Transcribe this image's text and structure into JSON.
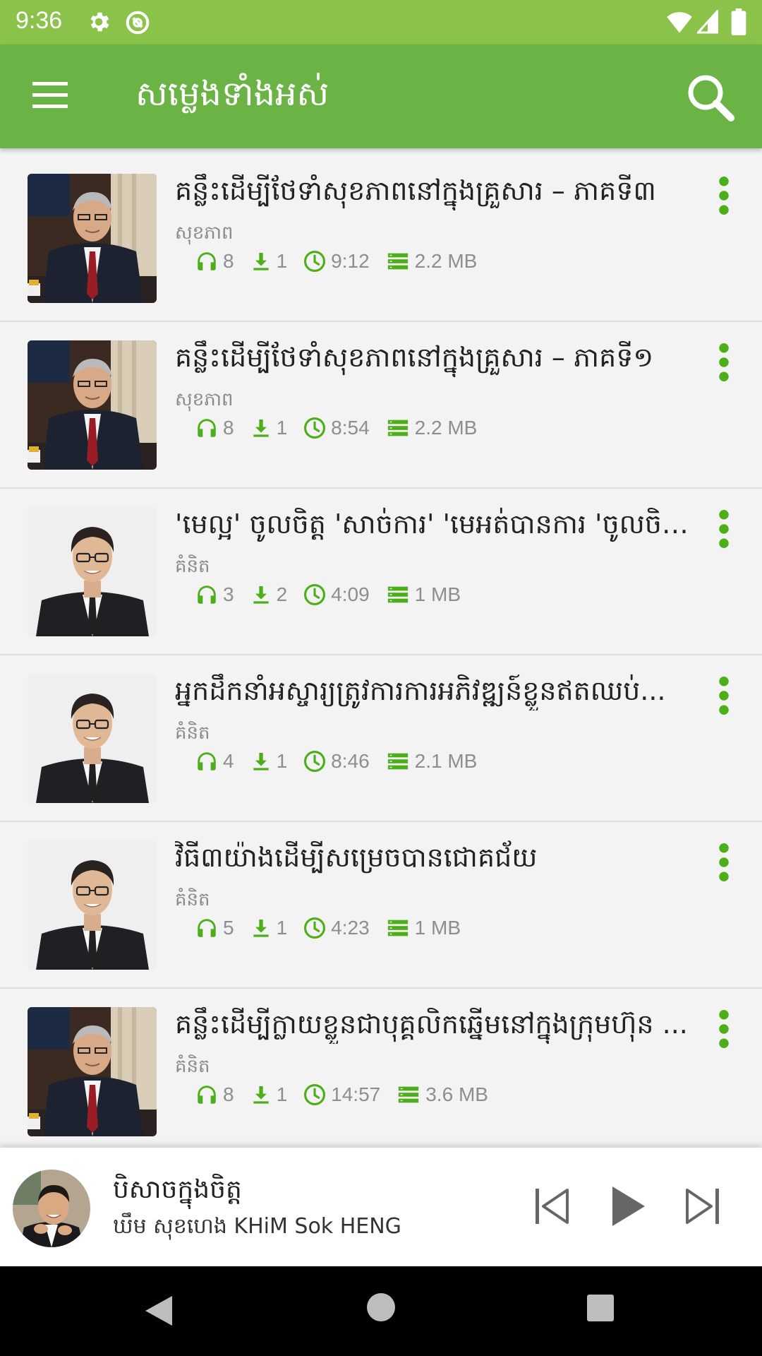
{
  "status_bar": {
    "time": "9:36",
    "icons": [
      "gear-icon",
      "ring-icon",
      "wifi-icon",
      "signal-icon",
      "battery-icon"
    ]
  },
  "app_bar": {
    "title": "សម្លេងទាំងអស់",
    "icons": [
      "menu-icon",
      "search-icon"
    ]
  },
  "theme": {
    "accent": "#6ab344",
    "status_bar": "#8bc34a",
    "icon_green": "#4caf1a"
  },
  "items": [
    {
      "title": "គន្លឹះដើម្បីថែទាំសុខភាពនៅក្នុងគ្រួសារ – ភាគទី៣",
      "category": "សុខភាព",
      "thumb": "speaker-a",
      "listens": "8",
      "downloads": "1",
      "duration": "9:12",
      "size": "2.2 MB"
    },
    {
      "title": "គន្លឹះដើម្បីថែទាំសុខភាពនៅក្នុងគ្រួសារ – ភាគទី១",
      "category": "សុខភាព",
      "thumb": "speaker-a",
      "listens": "8",
      "downloads": "1",
      "duration": "8:54",
      "size": "2.2 MB"
    },
    {
      "title": "'មេល្អ' ចូលចិត្ត 'សាច់ការ' 'មេអត់បានការ 'ចូលចិត្ត ...",
      "category": "គំនិត",
      "thumb": "speaker-b",
      "listens": "3",
      "downloads": "2",
      "duration": "4:09",
      "size": "1 MB"
    },
    {
      "title": "អ្នកដឹកនាំអស្ចារ្យត្រូវការការអភិវឌ្ឍន៍ខ្លួនឥតឈប់...",
      "category": "គំនិត",
      "thumb": "speaker-b",
      "listens": "4",
      "downloads": "1",
      "duration": "8:46",
      "size": "2.1 MB"
    },
    {
      "title": "វិធី៣យ៉ាងដើម្បីសម្រេចបានជោគជ័យ",
      "category": "គំនិត",
      "thumb": "speaker-b",
      "listens": "5",
      "downloads": "1",
      "duration": "4:23",
      "size": "1 MB"
    },
    {
      "title": "គន្លឹះដើម្បីក្លាយខ្លួនជាបុគ្គលិកឆ្នើមនៅក្នុងក្រុមហ៊ុន ...",
      "category": "គំនិត",
      "thumb": "speaker-a",
      "listens": "8",
      "downloads": "1",
      "duration": "14:57",
      "size": "3.6 MB"
    }
  ],
  "player": {
    "title": "បិសាចក្នុងចិត្ត",
    "artist": "ឃឹម សុខហេង KHiM Sok HENG",
    "controls": [
      "previous-icon",
      "play-icon",
      "next-icon"
    ]
  },
  "nav_bar": {
    "icons": [
      "back-icon",
      "home-icon",
      "recents-icon"
    ]
  }
}
